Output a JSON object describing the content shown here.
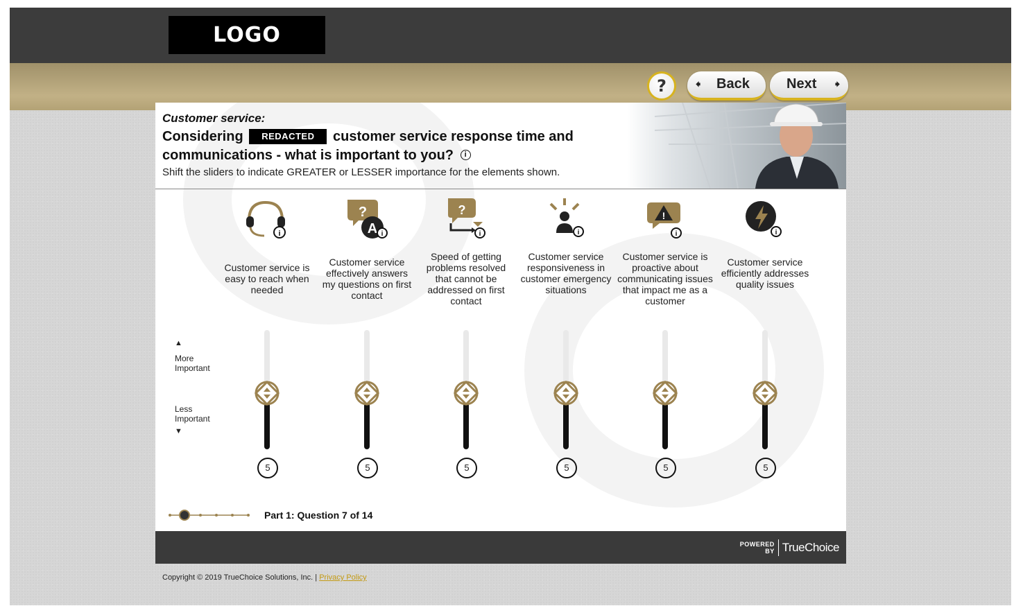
{
  "header": {
    "logo_text": "LOGO",
    "help_label": "?",
    "back_label": "Back",
    "next_label": "Next"
  },
  "question": {
    "section_title": "Customer service:",
    "prefix": "Considering",
    "redacted": "REDACTED",
    "text": "customer service response time and communications - what is important to you?",
    "info_glyph": "i",
    "instructions": "Shift the sliders to indicate GREATER or LESSER importance for the elements shown."
  },
  "scale": {
    "more_label_1": "More",
    "more_label_2": "Important",
    "less_label_1": "Less",
    "less_label_2": "Important"
  },
  "items": [
    {
      "label": "Customer service is easy to reach when needed",
      "icon": "headset-icon",
      "value": "5"
    },
    {
      "label": "Customer service effectively answers my questions on first contact",
      "icon": "question-answer-icon",
      "value": "5"
    },
    {
      "label": "Speed of getting problems resolved that cannot be addressed on first contact",
      "icon": "question-hourglass-icon",
      "value": "5"
    },
    {
      "label": "Customer service responsiveness in customer emergency situations",
      "icon": "alert-person-icon",
      "value": "5"
    },
    {
      "label": "Customer service is proactive about communicating issues that impact me as a customer",
      "icon": "warning-bubble-icon",
      "value": "5"
    },
    {
      "label": "Customer service efficiently addresses quality issues",
      "icon": "lightning-icon",
      "value": "5"
    }
  ],
  "progress": {
    "text": "Part 1: Question 7 of 14",
    "current_step": 1,
    "total_steps": 6
  },
  "footer": {
    "powered_1": "POWERED",
    "powered_2": "BY",
    "brand": "TrueChoice",
    "copyright": "Copyright © 2019 TrueChoice Solutions, Inc. |",
    "privacy": "Privacy Policy"
  },
  "colors": {
    "gold": "#9c8350",
    "accent_yellow": "#d7b31f",
    "dark": "#3c3c3c"
  }
}
